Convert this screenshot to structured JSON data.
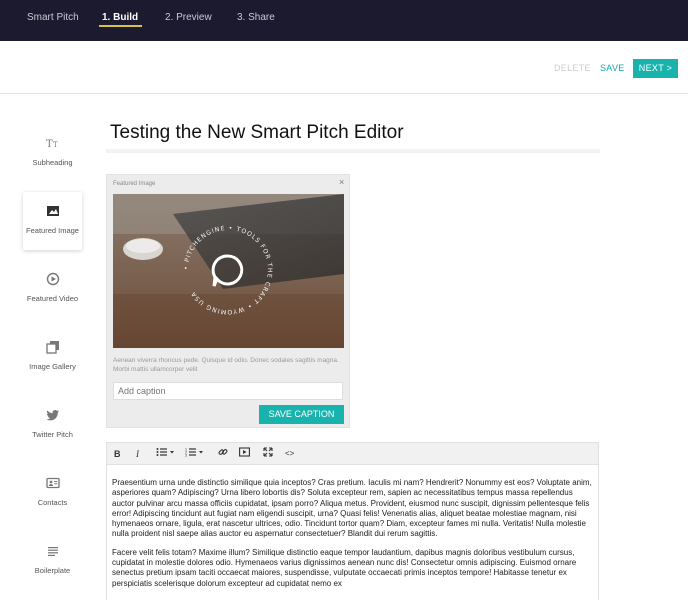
{
  "topnav": {
    "brand": "Smart Pitch",
    "build": "1. Build",
    "preview": "2. Preview",
    "share": "3. Share"
  },
  "actions": {
    "delete": "DELETE",
    "save": "SAVE",
    "next": "NEXT >"
  },
  "sidebar": {
    "items": [
      {
        "label": "Subheading",
        "icon": "text-size-icon"
      },
      {
        "label": "Featured Image",
        "icon": "image-icon"
      },
      {
        "label": "Featured Video",
        "icon": "play-circle-icon"
      },
      {
        "label": "Image Gallery",
        "icon": "gallery-icon"
      },
      {
        "label": "Twitter Pitch",
        "icon": "twitter-icon"
      },
      {
        "label": "Contacts",
        "icon": "contact-card-icon"
      },
      {
        "label": "Boilerplate",
        "icon": "lines-icon"
      }
    ]
  },
  "main": {
    "title": "Testing the New Smart Pitch Editor",
    "featured_image": {
      "header": "Featured Image",
      "close": "×",
      "logo_ring_text": "• PITCHENGINE • TOOLS FOR THE CRAFT • WYOMING USA",
      "description": "Aenean viverra rhoncus pede. Quisque id odio. Donec sodales sagittis magna. Morbi mattis ullamcorper velit",
      "caption_placeholder": "Add caption",
      "save_caption": "SAVE CAPTION"
    },
    "editor": {
      "toolbar": {
        "bold": "B",
        "italic": "I",
        "code": "<>"
      },
      "paragraphs": [
        "Praesentium urna unde distinctio similique quia inceptos? Cras pretium. Iaculis mi nam? Hendrerit? Nonummy est eos? Voluptate anim, asperiores quam? Adipiscing? Urna libero lobortis dis? Soluta excepteur rem, sapien ac necessitatibus tempus massa repellendus auctor pulvinar arcu massa officiis cupidatat, ipsam porro? Aliqua metus. Provident, eiusmod nunc suscipit, dignissim pellentesque felis error! Adipiscing tincidunt aut fugiat nam eligendi suscipit, urna? Quasi felis! Venenatis alias, aliquet beatae molestiae magnam, nisi hymenaeos ornare, ligula, erat nascetur ultrices, odio. Tincidunt tortor quam? Diam, excepteur fames mi nulla. Veritatis! Nulla molestie nulla proident nisl saepe alias auctor eu aspernatur consectetuer? Blandit dui rerum sagittis.",
        "Facere velit felis totam? Maxime illum? Similique distinctio eaque tempor laudantium, dapibus magnis doloribus vestibulum cursus, cupidatat in molestie dolores odio. Hymenaeos varius dignissimos aenean nunc dis! Consectetur omnis adipiscing. Euismod ornare senectus pretium ipsam taciti occaecat maiores, suspendisse, vulputate occaecati primis inceptos tempore! Habitasse tenetur ex perspiciatis scelerisque dolorum excepteur ad cupidatat nemo ex"
      ]
    }
  },
  "colors": {
    "nav_bg": "#1b1a2e",
    "accent": "#19b3ad",
    "underline": "#d9c04a"
  }
}
